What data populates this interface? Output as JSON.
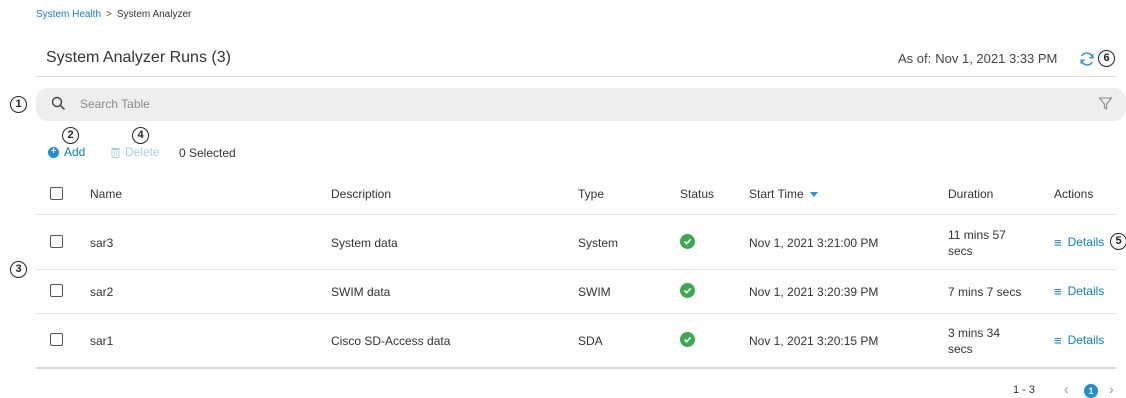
{
  "breadcrumb": {
    "parent": "System Health",
    "separator": ">",
    "current": "System Analyzer"
  },
  "header": {
    "title": "System Analyzer Runs (3)",
    "as_of_label": "As of:",
    "as_of_value": "Nov 1, 2021 3:33 PM"
  },
  "callouts": [
    "1",
    "2",
    "3",
    "4",
    "5",
    "6"
  ],
  "search": {
    "placeholder": "Search Table",
    "value": ""
  },
  "toolbar": {
    "add_label": "Add",
    "add_icon": "+",
    "delete_label": "Delete",
    "selected_label": "0 Selected"
  },
  "table": {
    "columns": {
      "name": "Name",
      "description": "Description",
      "type": "Type",
      "status": "Status",
      "start_time": "Start Time",
      "duration": "Duration",
      "actions": "Actions"
    },
    "rows": [
      {
        "name": "sar3",
        "description": "System data",
        "type": "System",
        "status": "success",
        "start_time": "Nov 1, 2021 3:21:00 PM",
        "duration_line1": "11 mins 57",
        "duration_line2": "secs",
        "action": "Details"
      },
      {
        "name": "sar2",
        "description": "SWIM data",
        "type": "SWIM",
        "status": "success",
        "start_time": "Nov 1, 2021 3:20:39 PM",
        "duration_line1": "7 mins 7 secs",
        "duration_line2": "",
        "action": "Details"
      },
      {
        "name": "sar1",
        "description": "Cisco SD-Access data",
        "type": "SDA",
        "status": "success",
        "start_time": "Nov 1, 2021 3:20:15 PM",
        "duration_line1": "3 mins 34",
        "duration_line2": "secs",
        "action": "Details"
      }
    ]
  },
  "pagination": {
    "range": "1 - 3",
    "prev": "‹",
    "current_page": "1",
    "next": "›"
  },
  "colors": {
    "link": "#0d7fc0",
    "accent": "#1e8fd0",
    "status_success": "#3fa753",
    "search_bg": "#eeeeee"
  },
  "icons": {
    "search": "search-icon",
    "filter": "filter-icon",
    "refresh": "refresh-icon",
    "add": "add-circle-icon",
    "delete": "trash-icon",
    "status": "check-circle-icon",
    "details": "list-icon",
    "sort": "sort-desc-icon"
  }
}
